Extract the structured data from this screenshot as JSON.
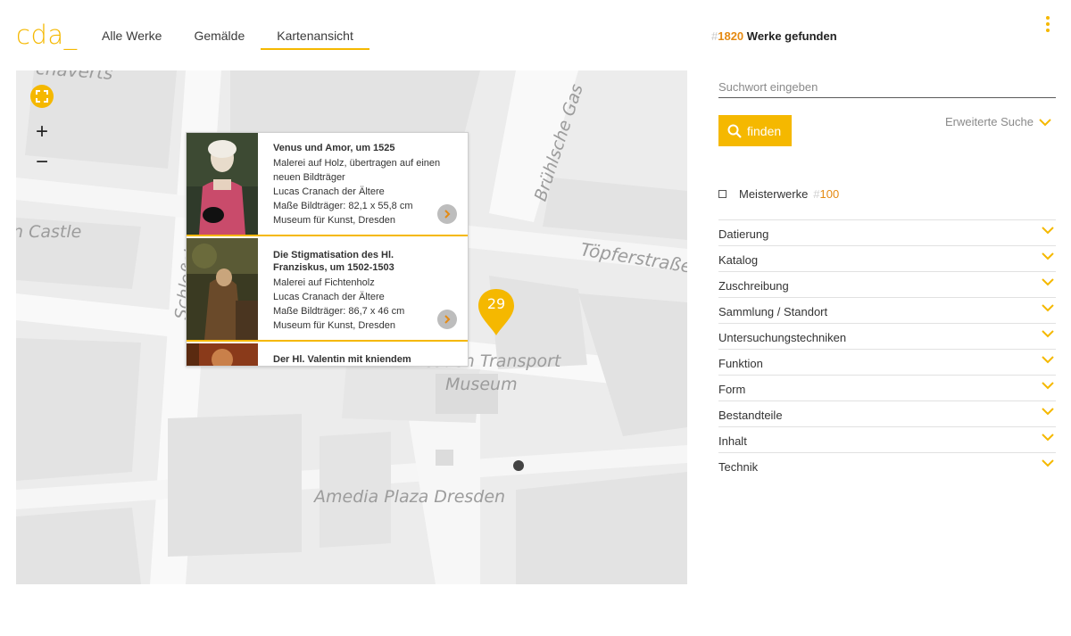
{
  "header": {
    "logo": "cda_",
    "tabs": [
      {
        "label": "Alle Werke"
      },
      {
        "label": "Gemälde"
      },
      {
        "label": "Kartenansicht"
      }
    ]
  },
  "map": {
    "labels": {
      "castle": "n Castle",
      "street_top": "chaverts",
      "bruehl": "Brühlsche Gas",
      "toepfer": "Töpferstraße",
      "schloss": "Schloßst",
      "transport_1": "Dresden Transport",
      "transport_2": "Museum",
      "amedia": "Amedia Plaza Dresden"
    },
    "controls": {
      "zoom_in": "+",
      "zoom_out": "−"
    },
    "cluster_count": "29",
    "accent_color": "#f5b800"
  },
  "popup": {
    "cards": [
      {
        "title": "Venus und Amor, um 1525",
        "lines": [
          "Malerei auf Holz, übertragen auf einen neuen Bildträger",
          "Lucas Cranach der Ältere",
          "Maße Bildträger: 82,1 x 55,8 cm",
          "Museum für Kunst, Dresden"
        ]
      },
      {
        "title": "Die Stigmatisation des Hl. Franziskus, um 1502-1503",
        "lines": [
          "Malerei auf Fichtenholz",
          "Lucas Cranach der Ältere",
          "Maße Bildträger: 86,7 x 46 cm",
          "Museum für Kunst, Dresden"
        ]
      },
      {
        "title": "Der Hl. Valentin mit kniendem",
        "lines": []
      }
    ]
  },
  "results": {
    "hash": "#",
    "count": "1820",
    "label": "Werke gefunden"
  },
  "search": {
    "placeholder": "Suchwort eingeben",
    "button_label": "finden",
    "advanced_label": "Erweiterte Suche"
  },
  "masterworks": {
    "label": "Meisterwerke",
    "hash": "#",
    "count": "100"
  },
  "filters": [
    {
      "label": "Datierung"
    },
    {
      "label": "Katalog"
    },
    {
      "label": "Zuschreibung"
    },
    {
      "label": "Sammlung / Standort"
    },
    {
      "label": "Untersuchungstechniken"
    },
    {
      "label": "Funktion"
    },
    {
      "label": "Form"
    },
    {
      "label": "Bestandteile"
    },
    {
      "label": "Inhalt"
    },
    {
      "label": "Technik"
    }
  ]
}
